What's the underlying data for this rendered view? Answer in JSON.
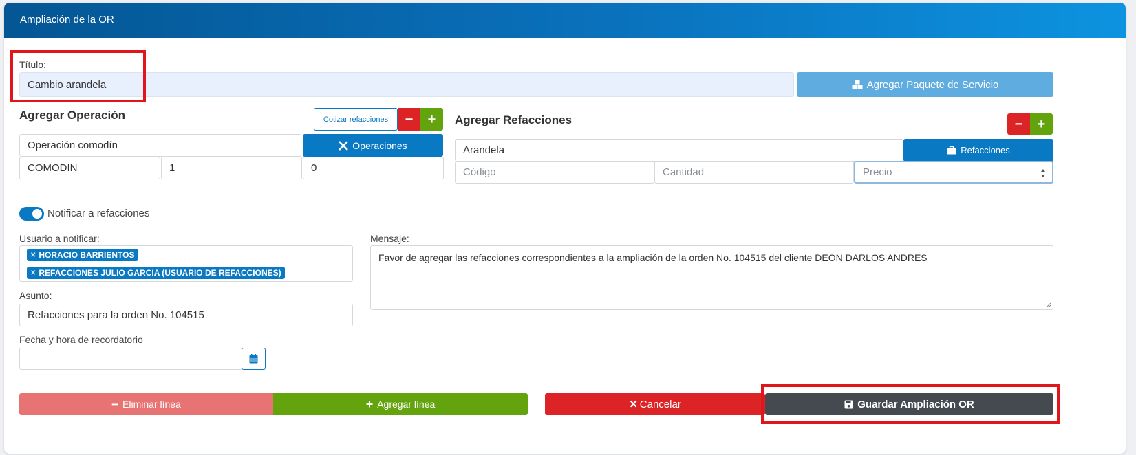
{
  "header": {
    "title": "Ampliación de la OR"
  },
  "titulo": {
    "label": "Título:",
    "value": "Cambio arandela"
  },
  "paquete_button": {
    "label": "Agregar Paquete de Servicio",
    "icon": "cubes-icon"
  },
  "operacion": {
    "title": "Agregar Operación",
    "cotizar_label": "Cotizar refacciones",
    "remove_label": "−",
    "add_label": "+",
    "nombre_value": "Operación comodín",
    "operaciones_label": "Operaciones",
    "codigo_value": "COMODIN",
    "cantidad_value": "1",
    "precio_value": "0"
  },
  "refacciones": {
    "title": "Agregar Refacciones",
    "remove_label": "−",
    "add_label": "+",
    "nombre_value": "Arandela",
    "refacciones_label": "Refacciones",
    "codigo_placeholder": "Código",
    "cantidad_placeholder": "Cantidad",
    "precio_placeholder": "Precio"
  },
  "notificar": {
    "toggle_label": "Notificar a refacciones",
    "toggle_on": true,
    "usuario_label": "Usuario a notificar:",
    "usuarios": [
      "HORACIO BARRIENTOS",
      "REFACCIONES JULIO GARCIA (USUARIO DE REFACCIONES)"
    ],
    "asunto_label": "Asunto:",
    "asunto_value": "Refacciones para la orden No. 104515",
    "fecha_label": "Fecha y hora de recordatorio",
    "fecha_value": "",
    "mensaje_label": "Mensaje:",
    "mensaje_value": "Favor de agregar las refacciones correspondientes a la ampliación de la orden No. 104515 del cliente DEON DARLOS ANDRES"
  },
  "actions": {
    "eliminar_label": "Eliminar línea",
    "agregar_label": "Agregar línea",
    "cancelar_label": "Cancelar",
    "guardar_label": "Guardar Ampliación OR"
  },
  "colors": {
    "header_start": "#045694",
    "header_end": "#0d93e0",
    "primary": "#0a79c4",
    "danger": "#dc2326",
    "success": "#62a30e",
    "dark": "#454a50",
    "highlight": "#e0161c"
  }
}
